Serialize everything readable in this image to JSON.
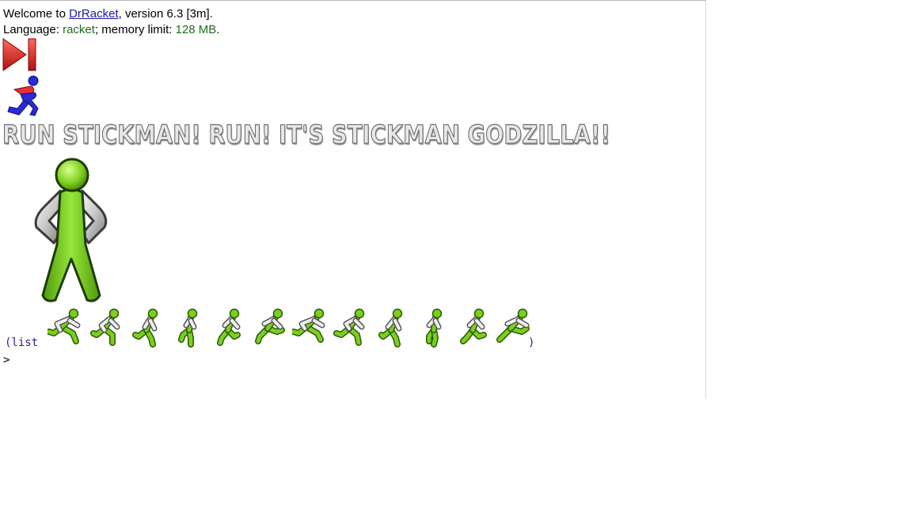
{
  "welcome": {
    "prefix": "Welcome to ",
    "app_link": "DrRacket",
    "suffix": ", version 6.3 [3m]."
  },
  "language": {
    "prefix": "Language: ",
    "lang": "racket",
    "middle": "; memory limit: ",
    "memory": "128 MB",
    "end": "."
  },
  "headline": "RUN STICKMAN! RUN! IT'S STICKMAN GODZILLA!!",
  "list_open": "(list",
  "list_close": ")",
  "prompt": ">",
  "colors": {
    "stick_green": "#7ccf1e",
    "link_blue": "#1a1aa6",
    "text_green": "#1f6f1f",
    "code_blue": "#22229a"
  },
  "frames": {
    "count": 12,
    "icon": "running-stickman-icon"
  }
}
